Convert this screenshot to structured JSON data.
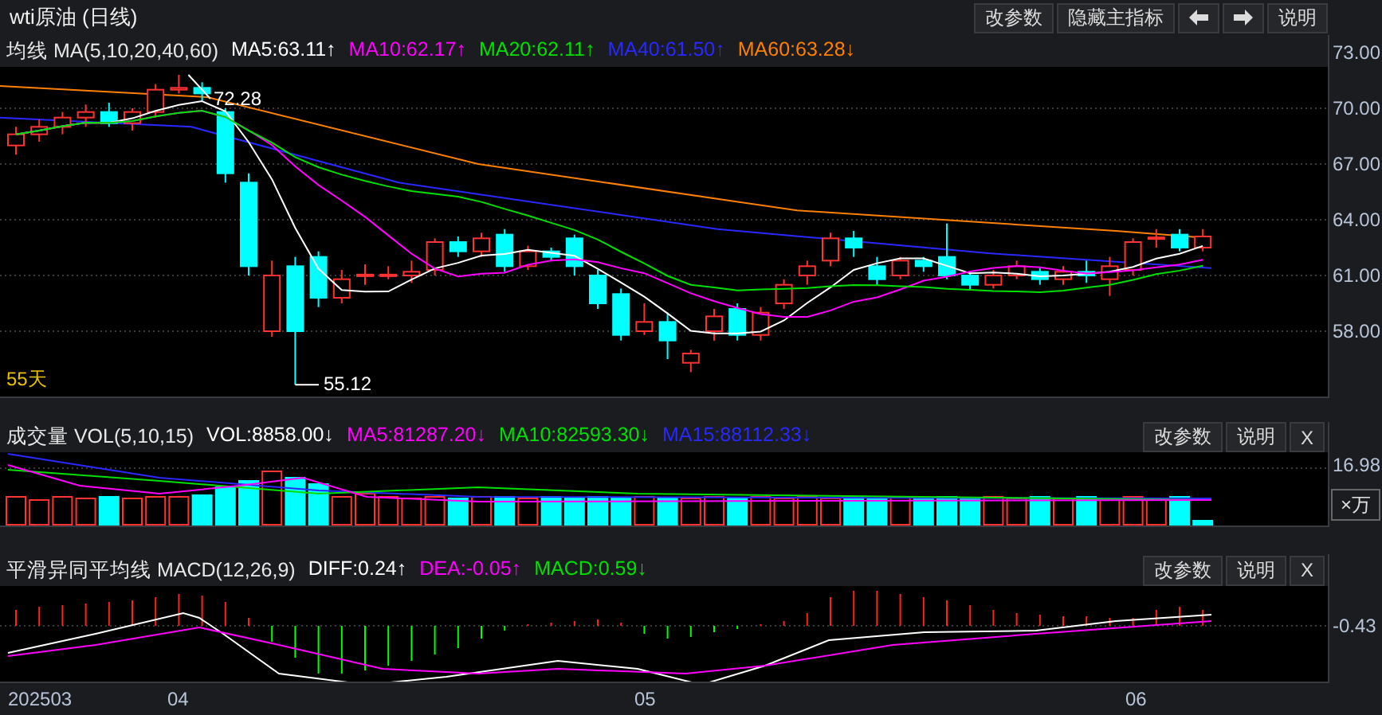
{
  "window": {
    "title": "wti原油 (日线)"
  },
  "toolbar": {
    "buttons": [
      {
        "kind": "text",
        "label": "改参数"
      },
      {
        "kind": "text",
        "label": "隐藏主指标"
      },
      {
        "kind": "arrow-left"
      },
      {
        "kind": "arrow-right"
      },
      {
        "kind": "text",
        "label": "说明"
      }
    ]
  },
  "price_panel": {
    "indicator": "均线 MA(5,10,20,40,60)",
    "series": [
      {
        "label": "MA5:63.11↑",
        "color": "#ffffff"
      },
      {
        "label": "MA10:62.17↑",
        "color": "#ff00ff"
      },
      {
        "label": "MA20:62.11↑",
        "color": "#00e000"
      },
      {
        "label": "MA40:61.50↑",
        "color": "#2828ff"
      },
      {
        "label": "MA60:63.28↓",
        "color": "#ff8000"
      }
    ],
    "axis_labels": [
      "73.00",
      "70.00",
      "67.00",
      "64.00",
      "61.00",
      "58.00"
    ],
    "high_label": "72.28",
    "low_label": "55.12",
    "period_label": "55天"
  },
  "volume_panel": {
    "indicator": "成交量 VOL(5,10,15)",
    "series": [
      {
        "label": "VOL:8858.00↓",
        "color": "#ffffff"
      },
      {
        "label": "MA5:81287.20↓",
        "color": "#ff00ff"
      },
      {
        "label": "MA10:82593.30↓",
        "color": "#00e000"
      },
      {
        "label": "MA15:88112.33↓",
        "color": "#2828ff"
      }
    ],
    "buttons": [
      "改参数",
      "说明",
      "X"
    ],
    "axis_label": "16.98",
    "unit_button": "×万"
  },
  "macd_panel": {
    "indicator": "平滑异同平均线 MACD(12,26,9)",
    "series": [
      {
        "label": "DIFF:0.24↑",
        "color": "#ffffff"
      },
      {
        "label": "DEA:-0.05↑",
        "color": "#ff00ff"
      },
      {
        "label": "MACD:0.59↓",
        "color": "#00e000"
      }
    ],
    "buttons": [
      "改参数",
      "说明",
      "X"
    ],
    "axis_label": "-0.43"
  },
  "date_axis": [
    "202503",
    "04",
    "05",
    "06"
  ]
}
